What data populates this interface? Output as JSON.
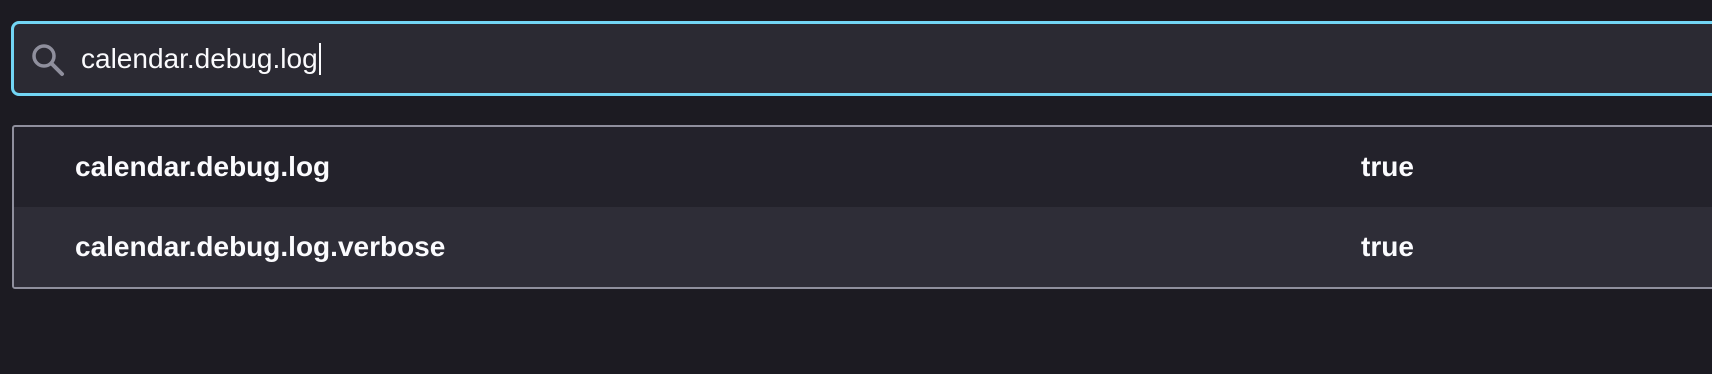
{
  "search": {
    "value": "calendar.debug.log",
    "icon": "search-icon",
    "accent_color": "#72d5f4"
  },
  "preferences": [
    {
      "name": "calendar.debug.log",
      "value": "true"
    },
    {
      "name": "calendar.debug.log.verbose",
      "value": "true"
    }
  ],
  "colors": {
    "background": "#1c1b22",
    "row_alt": "#2e2d37",
    "text": "#fbfbfe"
  }
}
